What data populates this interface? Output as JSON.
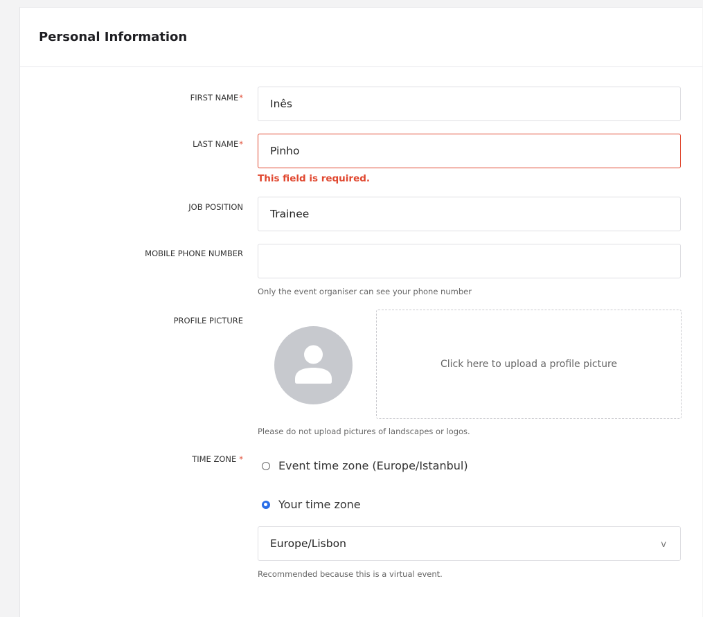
{
  "section": {
    "title": "Personal Information"
  },
  "form": {
    "first_name": {
      "label": "FIRST NAME",
      "required_mark": "*",
      "value": "Inês"
    },
    "last_name": {
      "label": "LAST NAME",
      "required_mark": "*",
      "value": "Pinho",
      "error": "This field is required."
    },
    "job_position": {
      "label": "JOB POSITION",
      "value": "Trainee"
    },
    "mobile_phone": {
      "label": "MOBILE PHONE NUMBER",
      "value": "",
      "hint": "Only the event organiser can see your phone number"
    },
    "profile_picture": {
      "label": "PROFILE PICTURE",
      "upload_prompt": "Click here to upload a profile picture",
      "hint": "Please do not upload pictures of landscapes or logos.",
      "avatar_icon": "person-placeholder-icon"
    },
    "time_zone": {
      "label": "TIME ZONE",
      "required_mark": "*",
      "options": [
        {
          "label": "Event time zone (Europe/Istanbul)",
          "checked": false
        },
        {
          "label": "Your time zone",
          "checked": true
        }
      ],
      "selected_zone": "Europe/Lisbon",
      "chevron": "v",
      "hint": "Recommended because this is a virtual event."
    }
  },
  "colors": {
    "error": "#e0472f",
    "accent": "#2a6ee8",
    "avatar_bg": "#c7c9ce"
  }
}
